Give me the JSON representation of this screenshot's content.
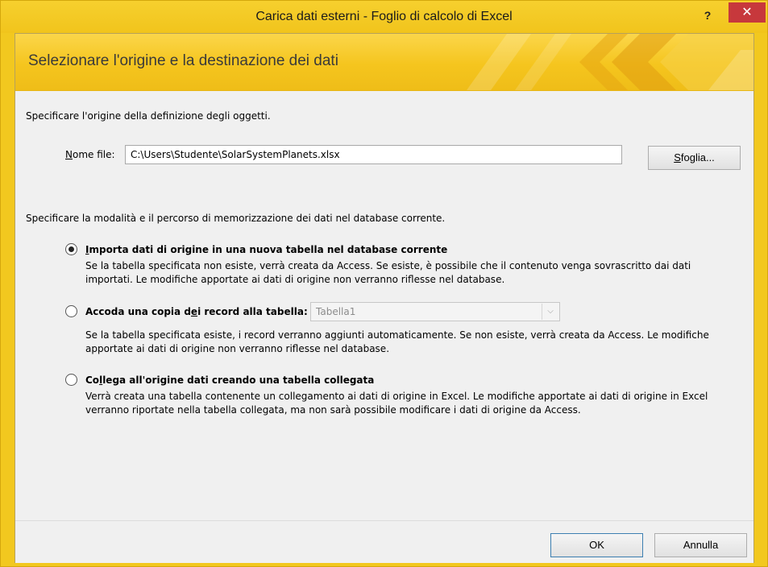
{
  "window": {
    "title": "Carica dati esterni - Foglio di calcolo di Excel",
    "help_label": "?",
    "close_label": "✕"
  },
  "banner": {
    "title": "Selezionare l'origine e la destinazione dei dati"
  },
  "source": {
    "instruction": "Specificare l'origine della definizione degli oggetti.",
    "filename_label_accel": "N",
    "filename_label_rest": "ome file:",
    "filename_value": "C:\\Users\\Studente\\SolarSystemPlanets.xlsx",
    "browse_accel": "S",
    "browse_rest": "foglia..."
  },
  "destination": {
    "instruction": "Specificare la modalità e il percorso di memorizzazione dei dati nel database corrente.",
    "options": [
      {
        "pre": "",
        "accel": "I",
        "post": "mporta dati di origine in una nuova tabella nel database corrente",
        "selected": true,
        "description": "Se la tabella specificata non esiste, verrà creata da Access. Se esiste, è possibile che il contenuto venga sovrascritto dai dati importati. Le modifiche apportate ai dati di origine non verranno riflesse nel database."
      },
      {
        "pre": "Accoda una copia d",
        "accel": "e",
        "post": "i record alla tabella:",
        "selected": false,
        "combo_value": "Tabella1",
        "description": "Se la tabella specificata esiste, i record verranno aggiunti automaticamente. Se non esiste, verrà creata da Access. Le modifiche apportate ai dati di origine non verranno riflesse nel database."
      },
      {
        "pre": "Co",
        "accel": "l",
        "post": "lega all'origine dati creando una tabella collegata",
        "selected": false,
        "description": "Verrà creata una tabella contenente un collegamento ai dati di origine in Excel. Le modifiche apportate ai dati di origine in Excel verranno riportate nella tabella collegata, ma non sarà possibile modificare i dati di origine da Access."
      }
    ]
  },
  "footer": {
    "ok_label": "OK",
    "cancel_label": "Annulla"
  }
}
